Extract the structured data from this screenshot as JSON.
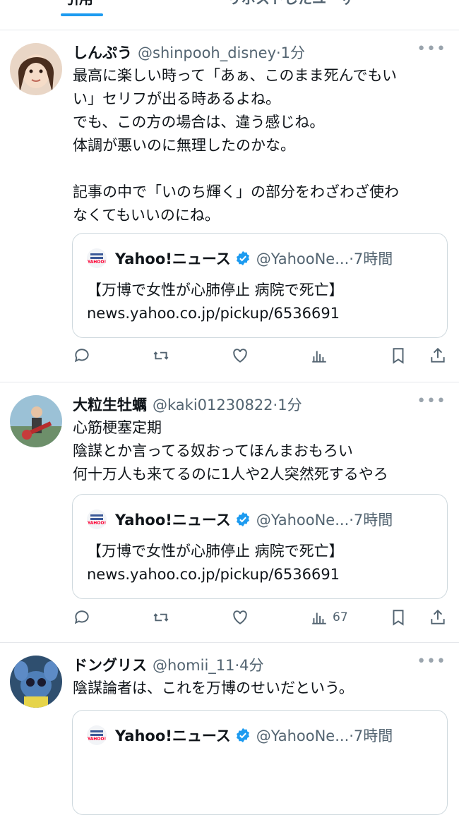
{
  "tabs": [
    {
      "label": "引用",
      "active": true
    },
    {
      "label": "リポストしたユーザー",
      "active": false
    }
  ],
  "colors": {
    "accent": "#1d9bf0",
    "verified": "#1d9bf0",
    "text": "#0f1419",
    "muted": "#536471",
    "border": "#cfd9de"
  },
  "tweets": [
    {
      "name": "しんぷう",
      "handle": "@shinpooh_disney·1分",
      "body": "最高に楽しい時って「あぁ、このまま死んでもい\nい」セリフが出る時あるよね。\nでも、この方の場合は、違う感じね。\n体調が悪いのに無理したのかな。\n\n記事の中で「いのち輝く」の部分をわざわざ使わ\nなくてもいいのにね。",
      "quote": {
        "name": "Yahoo!ニュース",
        "handle": "@YahooNe...·7時間",
        "text": "【万博で女性が心肺停止 病院で死亡】\nnews.yahoo.co.jp/pickup/6536691"
      },
      "views": ""
    },
    {
      "name": "大粒生牡蠣",
      "handle": "@kaki01230822·1分",
      "body": "心筋梗塞定期\n陰謀とか言ってる奴おってほんまおもろい\n何十万人も来てるのに1人や2人突然死するやろ",
      "quote": {
        "name": "Yahoo!ニュース",
        "handle": "@YahooNe...·7時間",
        "text": "【万博で女性が心肺停止 病院で死亡】\nnews.yahoo.co.jp/pickup/6536691"
      },
      "views": "67"
    },
    {
      "name": "ドングリス",
      "handle": "@homii_11·4分",
      "body": "陰謀論者は、これを万博のせいだという。",
      "quote": {
        "name": "Yahoo!ニュース",
        "handle": "@YahooNe...·7時間",
        "text": ""
      },
      "views": ""
    }
  ],
  "icons": {
    "more": "more-icon",
    "reply": "reply-icon",
    "repost": "repost-icon",
    "like": "heart-icon",
    "views": "views-icon",
    "bookmark": "bookmark-icon",
    "share": "share-icon"
  }
}
